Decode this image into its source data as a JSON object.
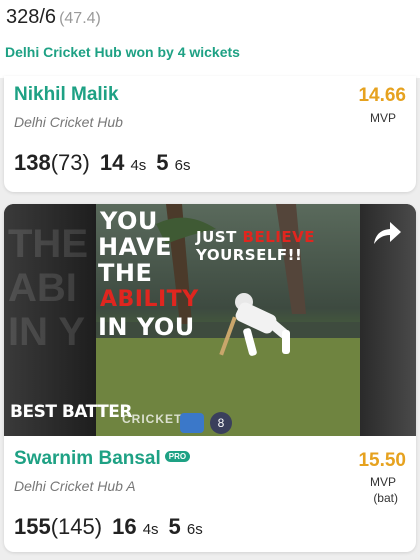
{
  "summary": {
    "score": "328/6",
    "overs": "(47.4)",
    "result": "Delhi Cricket Hub won by 4 wickets"
  },
  "players": [
    {
      "name": "Nikhil Malik",
      "team": "Delhi Cricket Hub",
      "mvp_value": "14.66",
      "mvp_label": "MVP",
      "runs": "138",
      "balls": "(73)",
      "fours": "14",
      "fours_label": "4s",
      "sixes": "5",
      "sixes_label": "6s"
    },
    {
      "name": "Swarnim Bansal",
      "badge": "PRO",
      "team": "Delhi Cricket Hub A",
      "mvp_value": "15.50",
      "mvp_label": "MVP",
      "mvp_sub": "(bat)",
      "runs": "155",
      "balls": "(145)",
      "fours": "16",
      "fours_label": "4s",
      "sixes": "5",
      "sixes_label": "6s"
    }
  ],
  "media": {
    "poster_line1": "YOU",
    "poster_line2": "HAVE",
    "poster_line3": "THE",
    "poster_line4": "ABILITY",
    "poster_line5": "IN YOU",
    "poster_right1_a": "JUST",
    "poster_right1_b": "BELIEVE",
    "poster_right2": "YOURSELF!!",
    "ghost1": "THE",
    "ghost2": "ABI",
    "ghost3": "IN Y",
    "award": "BEST BATTER",
    "app_logo": "CRICKET",
    "badge_number": "8"
  },
  "icons": {
    "share": "share-arrow-icon"
  },
  "colors": {
    "name_green": "#1ea184",
    "mvp_gold": "#e6a21f",
    "poster_red": "#e0261f"
  }
}
